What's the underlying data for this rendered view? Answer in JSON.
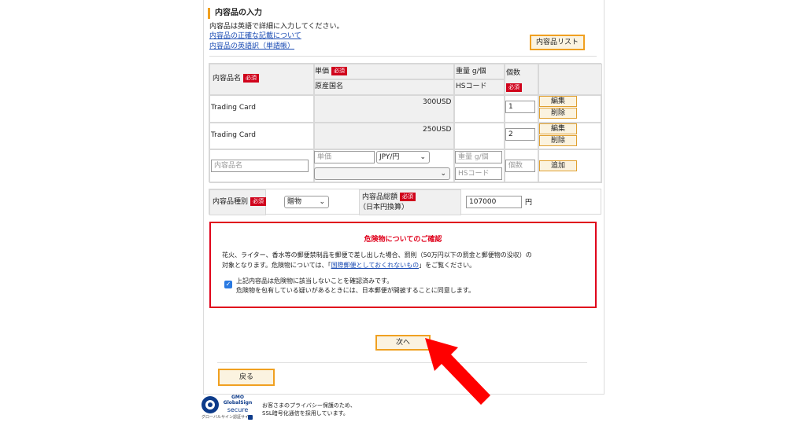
{
  "section": {
    "title": "内容品の入力",
    "instruction": "内容品は英語で詳細に入力してください。",
    "link_accurate": "内容品の正確な記載について",
    "link_glossary": "内容品の英語訳（単語帳）",
    "list_button": "内容品リスト"
  },
  "table": {
    "header_name": "内容品名",
    "header_price": "単価",
    "header_origin": "原産国名",
    "header_weight": "重量 g/個",
    "header_hs": "HSコード",
    "header_qty": "個数",
    "required": "必須"
  },
  "items": [
    {
      "name": "Trading Card",
      "price": "300USD",
      "qty": "1",
      "edit": "編集",
      "delete": "削除"
    },
    {
      "name": "Trading Card",
      "price": "250USD",
      "qty": "2",
      "edit": "編集",
      "delete": "削除"
    }
  ],
  "new_item": {
    "name_placeholder": "内容品名",
    "price_placeholder": "単価",
    "currency": "JPY/円",
    "weight_placeholder": "重量 g/個",
    "hs_placeholder": "HSコード",
    "qty_placeholder": "個数",
    "add_button": "追加"
  },
  "category": {
    "label": "内容品種別",
    "value": "贈物",
    "total_label_1": "内容品総額",
    "total_label_2": "（日本円換算）",
    "total_value": "107000",
    "unit": "円"
  },
  "warning": {
    "title": "危険物についてのご確認",
    "line1": "花火、ライター、香水等の郵便禁制品を郵便で差し出した場合、罰則（50万円以下の罰金と郵便物の没収）の",
    "line2_pre": "対象となります。危険物については、「",
    "line2_link": "国際郵便としておくれないもの",
    "line2_post": "」をご覧ください。",
    "check1": "上記内容品は危険物に該当しないことを確認済みです。",
    "check2": "危険物を包有している疑いがあるときには、日本郵便が開披することに同意します。"
  },
  "buttons": {
    "next": "次へ",
    "back": "戻る"
  },
  "footer": {
    "brand_gmo": "GMO",
    "brand_gs": "GlobalSign",
    "brand_secure": "secure",
    "brand_caption": "グローバルサイン認証サイト",
    "note1": "お客さまのプライバシー保護のため、",
    "note2": "SSL暗号化通信を採用しています。"
  },
  "colors": {
    "accent": "#f0a020",
    "required": "#d0021b",
    "warning_border": "#e0001b",
    "link": "#1a4bb3",
    "arrow": "#ff0000"
  }
}
